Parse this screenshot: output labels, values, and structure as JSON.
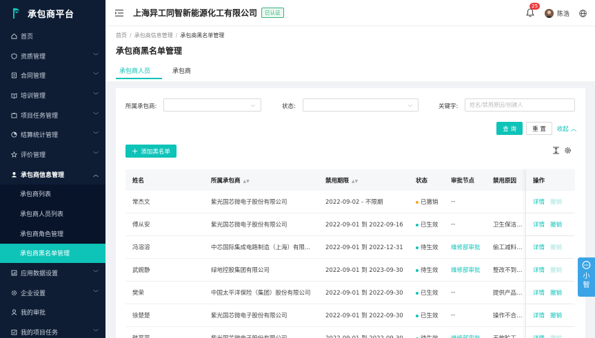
{
  "app": {
    "name": "承包商平台"
  },
  "sidebar": {
    "items": [
      {
        "label": "首页",
        "icon": "home-icon",
        "has_children": false
      },
      {
        "label": "资质管理",
        "icon": "certificate-icon",
        "has_children": true
      },
      {
        "label": "合同管理",
        "icon": "contract-icon",
        "has_children": true
      },
      {
        "label": "培训管理",
        "icon": "training-icon",
        "has_children": true
      },
      {
        "label": "项目任务管理",
        "icon": "project-icon",
        "has_children": true
      },
      {
        "label": "结算统计管理",
        "icon": "settlement-icon",
        "has_children": true
      },
      {
        "label": "评价管理",
        "icon": "star-icon",
        "has_children": true
      },
      {
        "label": "承包商信息管理",
        "icon": "user-icon",
        "has_children": true,
        "expanded": true,
        "children": [
          {
            "label": "承包商列表",
            "active": false
          },
          {
            "label": "承包商人员列表",
            "active": false
          },
          {
            "label": "承包商角色管理",
            "active": false
          },
          {
            "label": "承包商黑名单管理",
            "active": true
          }
        ]
      },
      {
        "label": "应用数据设置",
        "icon": "data-icon",
        "has_children": true
      },
      {
        "label": "企业设置",
        "icon": "settings-icon",
        "has_children": true
      },
      {
        "label": "我的审批",
        "icon": "approval-icon",
        "has_children": false
      },
      {
        "label": "我的项目任务",
        "icon": "task-icon",
        "has_children": true
      }
    ]
  },
  "header": {
    "company": "上海异工同智新能源化工有限公司",
    "verified": "已认证",
    "notifications": "25",
    "user": "陈浩"
  },
  "breadcrumb": [
    "首页",
    "承包商信息管理",
    "承包商黑名单管理"
  ],
  "page": {
    "title": "承包商黑名单管理",
    "tabs": [
      {
        "label": "承包商人员",
        "active": true
      },
      {
        "label": "承包商",
        "active": false
      }
    ]
  },
  "filters": {
    "contractor_label": "所属承包商:",
    "status_label": "状态:",
    "keyword_label": "关键字:",
    "keyword_placeholder": "姓名/禁用原因/创建人",
    "query": "查 询",
    "reset": "重 置",
    "collapse": "收起"
  },
  "toolbar": {
    "add": "添加黑名单"
  },
  "table": {
    "columns": [
      "姓名",
      "所属承包商",
      "禁用期限",
      "状态",
      "审批节点",
      "禁用原因",
      "操作"
    ],
    "rows": [
      {
        "name": "常杰文",
        "contractor": "紫光国芯微电子股份有限公司",
        "period": "2022-09-02 - 不限期",
        "status": "已撤销",
        "status_color": "#f5a623",
        "node": "--",
        "reason": "",
        "detail": "详情",
        "revoke": "撤销",
        "revoke_enabled": false
      },
      {
        "name": "傅从安",
        "contractor": "紫光国芯微电子股份有限公司",
        "period": "2022-09-01 到 2022-09-16",
        "status": "已生效",
        "status_color": "#0ec3b8",
        "node": "--",
        "reason": "卫生保洁不到",
        "detail": "详情",
        "revoke": "撤销",
        "revoke_enabled": true
      },
      {
        "name": "冯溶溶",
        "contractor": "中芯国际集成电路制造（上海）有限...",
        "period": "2022-09-01 到 2022-12-31",
        "status": "待生效",
        "status_color": "#0ec3b8",
        "node": "维修部审批",
        "reason": "偷工减料，整",
        "detail": "详情",
        "revoke": "撤销",
        "revoke_enabled": false
      },
      {
        "name": "武婉静",
        "contractor": "绿地控股集团有限公司",
        "period": "2022-09-01 到 2023-09-30",
        "status": "待生效",
        "status_color": "#0ec3b8",
        "node": "维修部审批",
        "reason": "整改不到位，",
        "detail": "详情",
        "revoke": "撤销",
        "revoke_enabled": false
      },
      {
        "name": "樊荣",
        "contractor": "中国太平洋保险（集团）股份有限公司",
        "period": "2022-09-01 到 2022-09-30",
        "status": "已生效",
        "status_color": "#0ec3b8",
        "node": "--",
        "reason": "提供产品不真",
        "detail": "详情",
        "revoke": "撤销",
        "revoke_enabled": true
      },
      {
        "name": "徐楚楚",
        "contractor": "紫光国芯微电子股份有限公司",
        "period": "2022-09-01 到 2022-09-30",
        "status": "已生效",
        "status_color": "#0ec3b8",
        "node": "--",
        "reason": "操作不合格，",
        "detail": "详情",
        "revoke": "撤销",
        "revoke_enabled": true
      },
      {
        "name": "韩菲菲",
        "contractor": "紫光国芯微电子股份有限公司",
        "period": "2022-09-01 到 2022-09-30",
        "status": "待生效",
        "status_color": "#0ec3b8",
        "node": "维修部审批",
        "reason": "无故旷工，偷",
        "detail": "详情",
        "revoke": "撤销",
        "revoke_enabled": false
      }
    ]
  },
  "float_widget": {
    "text": "小智"
  }
}
